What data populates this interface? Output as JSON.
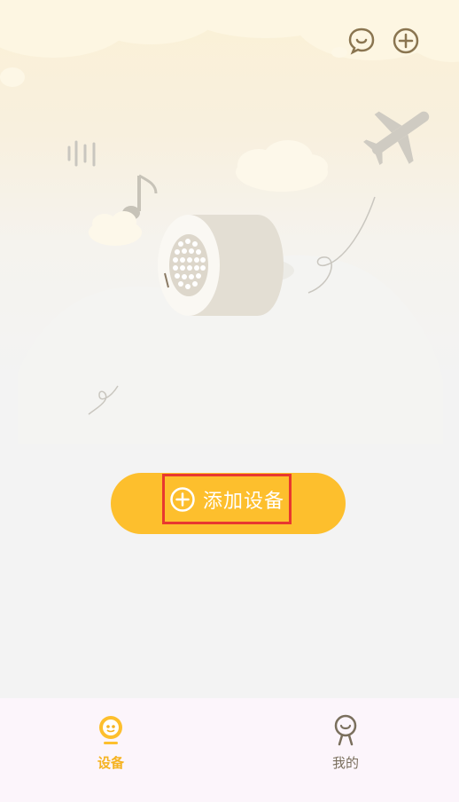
{
  "header": {
    "icons": [
      "chat-bubble-icon",
      "plus-circle-icon"
    ]
  },
  "main": {
    "illustration": "speaker-illustration",
    "add_device_label": "添加设备"
  },
  "tabbar": {
    "tabs": [
      {
        "label": "设备",
        "icon": "device-smiley-icon",
        "active": true
      },
      {
        "label": "我的",
        "icon": "person-icon",
        "active": false
      }
    ]
  },
  "colors": {
    "accent": "#fdbf2d",
    "highlight_border": "#e8382f",
    "tab_active": "#f5b321",
    "tab_inactive": "#7a6f5d",
    "icon_brown": "#8a7550"
  }
}
